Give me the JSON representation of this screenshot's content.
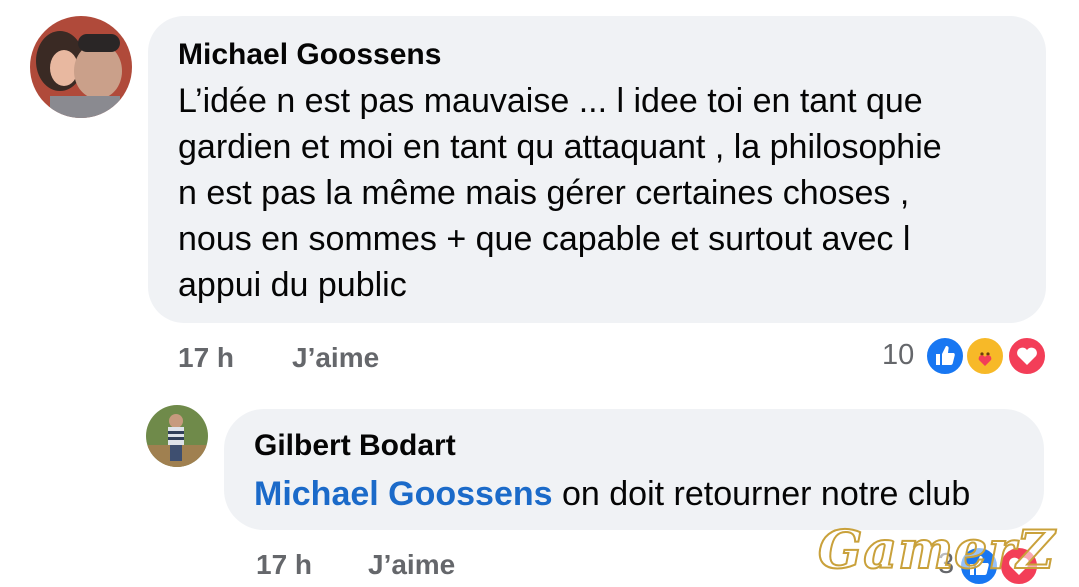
{
  "comment": {
    "author": "Michael Goossens",
    "lines": [
      "L’idée n est pas mauvaise ... l idee toi en tant que",
      "gardien et moi en tant qu attaquant , la philosophie",
      "n est pas la même mais gérer certaines choses ,",
      "nous en sommes + que capable et surtout avec l",
      "appui du public"
    ],
    "time": "17 h",
    "like_label": "J’aime",
    "reaction_count": "10",
    "reactions": [
      "like-reaction-icon",
      "care-reaction-icon",
      "love-reaction-icon"
    ]
  },
  "reply": {
    "author": "Gilbert Bodart",
    "mention": "Michael Goossens",
    "text": " on doit retourner notre club",
    "time": "17 h",
    "like_label": "J’aime",
    "reaction_count": "3",
    "reactions": [
      "like-reaction-icon",
      "love-reaction-icon"
    ]
  },
  "colors": {
    "bubble": "#f0f2f5",
    "mention": "#1b6ac9",
    "meta": "#65676b",
    "like": "#1877f2",
    "love": "#f33e58",
    "care": "#f7b928"
  }
}
